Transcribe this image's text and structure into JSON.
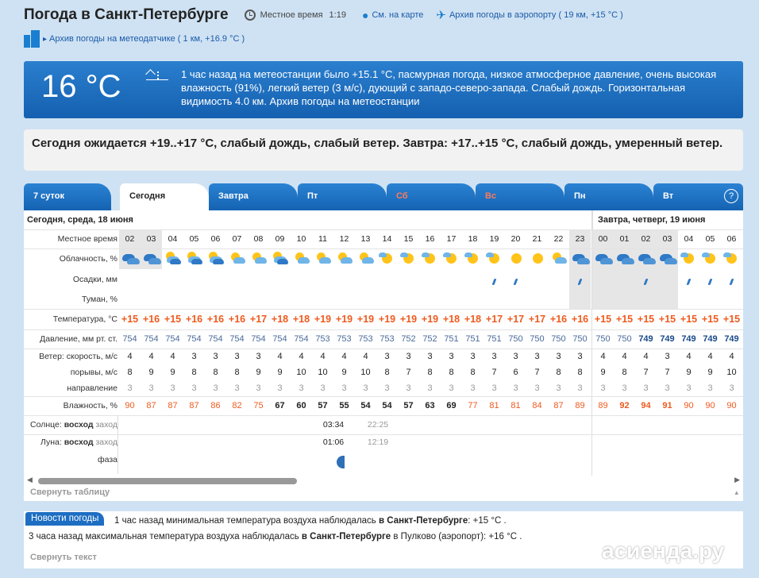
{
  "header": {
    "title": "Погода в Санкт-Петербурге",
    "local_time_label": "Местное время",
    "local_time": "1:19",
    "map_link": "См. на карте",
    "airport_link": "Архив погоды в аэропорту ( 19 км, +15 °C )",
    "sensor_link": "Архив погоды на метеодатчике ( 1 км, +16.9 °C )"
  },
  "current": {
    "temp": "16 °C",
    "text": "1 час назад на метеостанции было +15.1 °C, пасмурная погода, низкое атмосферное давление, очень высокая влажность (91%), легкий ветер (3 м/с), дующий с западо-северо-запада. Слабый дождь. Горизонтальная видимость 4.0 км. Архив погоды на метеостанции"
  },
  "forecast_text": "Сегодня ожидается +19..+17 °C, слабый дождь, слабый ветер. Завтра: +17..+15 °C, слабый дождь, умеренный ветер.",
  "tabs": [
    {
      "label": "7 суток",
      "active": false
    },
    {
      "label": "Сегодня",
      "active": true
    },
    {
      "label": "Завтра",
      "active": false
    },
    {
      "label": "Пт",
      "active": false
    },
    {
      "label": "Сб",
      "active": false,
      "weekend": true
    },
    {
      "label": "Вс",
      "active": false,
      "weekend": true
    },
    {
      "label": "Пн",
      "active": false
    },
    {
      "label": "Вт",
      "active": false
    }
  ],
  "help_label": "?",
  "day1_label": "Сегодня, среда, 18 июня",
  "day2_label": "Завтра, четверг, 19 июня",
  "row_labels": {
    "time": "Местное время",
    "cloud": "Облачность, %",
    "precip": "Осадки, мм",
    "fog": "Туман, %",
    "temp": "Температура, °C",
    "pressure": "Давление, мм рт. ст.",
    "wind_speed": "Ветер: скорость, м/с",
    "gusts": "порывы, м/с",
    "direction": "направление",
    "humidity": "Влажность, %",
    "sun": "Солнце:",
    "sun_rise": "восход",
    "sun_set": "заход",
    "moon": "Луна:",
    "moon_rise": "восход",
    "moon_set": "заход",
    "phase": "фаза"
  },
  "hours": [
    "02",
    "03",
    "04",
    "05",
    "06",
    "07",
    "08",
    "09",
    "10",
    "11",
    "12",
    "13",
    "14",
    "15",
    "16",
    "17",
    "18",
    "19",
    "20",
    "21",
    "22",
    "23",
    "00",
    "01",
    "02",
    "03",
    "04",
    "05",
    "06"
  ],
  "sky": [
    "night-cloudy",
    "night-cloudy",
    "partly-cloudy",
    "partly-cloudy",
    "partly-cloudy",
    "partly-sunny",
    "partly-sunny",
    "partly-cloudy",
    "partly-sunny",
    "partly-sunny",
    "partly-sunny",
    "partly-sunny",
    "sunny-cloud",
    "sunny-cloud",
    "sunny-cloud",
    "sunny-cloud",
    "sunny-cloud",
    "sunny-cloud",
    "sunny",
    "sunny",
    "partly-sunny",
    "night-cloudy",
    "night-cloudy",
    "night-cloudy",
    "night-cloudy",
    "night-cloudy",
    "sunny-cloud",
    "sunny-cloud",
    "sunny-cloud"
  ],
  "rain": [
    0,
    0,
    0,
    0,
    0,
    0,
    0,
    0,
    0,
    0,
    0,
    0,
    0,
    0,
    0,
    0,
    0,
    1,
    1,
    0,
    0,
    1,
    0,
    0,
    1,
    0,
    1,
    1,
    1
  ],
  "temps": [
    "+15",
    "+16",
    "+15",
    "+16",
    "+16",
    "+16",
    "+17",
    "+18",
    "+18",
    "+19",
    "+19",
    "+19",
    "+19",
    "+19",
    "+19",
    "+18",
    "+18",
    "+17",
    "+17",
    "+17",
    "+16",
    "+16",
    "+15",
    "+15",
    "+15",
    "+15",
    "+15",
    "+15",
    "+15"
  ],
  "pressure": [
    "754",
    "754",
    "754",
    "754",
    "754",
    "754",
    "754",
    "754",
    "754",
    "753",
    "753",
    "753",
    "753",
    "752",
    "752",
    "751",
    "751",
    "751",
    "750",
    "750",
    "750",
    "750",
    "750",
    "750",
    "749",
    "749",
    "749",
    "749",
    "749"
  ],
  "pressure_bold_from": 24,
  "wind": [
    "4",
    "4",
    "4",
    "3",
    "3",
    "3",
    "3",
    "4",
    "4",
    "4",
    "4",
    "4",
    "3",
    "3",
    "3",
    "3",
    "3",
    "3",
    "3",
    "3",
    "3",
    "3",
    "4",
    "4",
    "4",
    "3",
    "4",
    "4",
    "4"
  ],
  "gusts": [
    "8",
    "9",
    "9",
    "8",
    "8",
    "8",
    "9",
    "9",
    "10",
    "10",
    "9",
    "10",
    "8",
    "7",
    "8",
    "8",
    "8",
    "7",
    "6",
    "7",
    "8",
    "8",
    "9",
    "8",
    "7",
    "7",
    "9",
    "9",
    "10"
  ],
  "direction": [
    "3",
    "3",
    "3",
    "3",
    "3",
    "3",
    "3",
    "3",
    "3",
    "3",
    "3",
    "3",
    "3",
    "3",
    "3",
    "3",
    "3",
    "3",
    "3",
    "3",
    "3",
    "3",
    "3",
    "3",
    "3",
    "3",
    "3",
    "3",
    "3"
  ],
  "humidity": [
    "90",
    "87",
    "87",
    "87",
    "86",
    "82",
    "75",
    "67",
    "60",
    "57",
    "55",
    "54",
    "54",
    "57",
    "63",
    "69",
    "77",
    "81",
    "81",
    "84",
    "87",
    "89",
    "89",
    "92",
    "94",
    "91",
    "90",
    "90",
    "90"
  ],
  "humidity_bold": [
    7,
    8,
    9,
    10,
    11,
    12,
    13,
    14,
    15,
    23,
    24,
    25
  ],
  "sun_rise": "03:34",
  "sun_set": "22:25",
  "moon_rise": "01:06",
  "moon_set": "12:19",
  "collapse_table": "Свернуть таблицу",
  "news": {
    "header": "Новости погоды",
    "line1_pre": "1 час назад минимальная температура воздуха наблюдалась",
    "line1_city": "в Санкт-Петербурге",
    "line1_post": ": +15 °С .",
    "line2_pre": "3 часа назад максимальная температура воздуха наблюдалась",
    "line2_city": "в Санкт-Петербурге",
    "line2_post": "в Пулково (аэропорт): +16 °С .",
    "collapse": "Свернуть текст"
  },
  "watermark": "асиенда.ру"
}
